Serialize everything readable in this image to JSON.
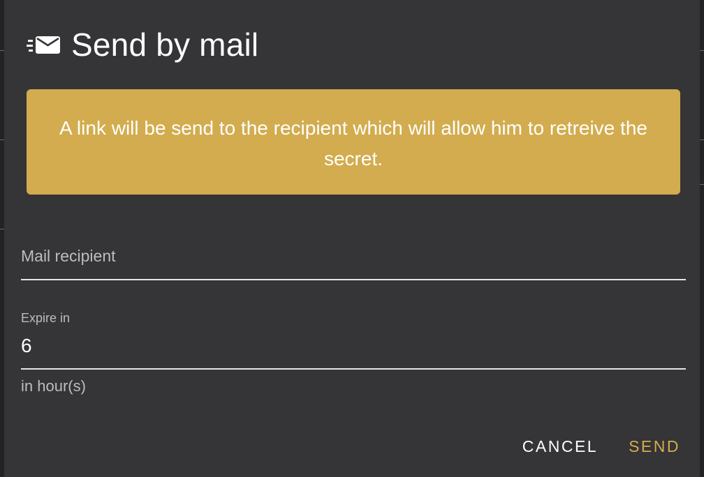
{
  "dialog": {
    "title": "Send by mail",
    "icon": "send-mail-icon"
  },
  "alert": {
    "message": "A link will be send to the recipient which will allow him to retreive the secret.",
    "color": "#d2ac4e"
  },
  "recipient_field": {
    "label": "Mail recipient",
    "value": ""
  },
  "expire_field": {
    "label": "Expire in",
    "value": "6",
    "hint": "in hour(s)"
  },
  "actions": {
    "cancel_label": "CANCEL",
    "send_label": "SEND"
  },
  "colors": {
    "accent": "#d2ac4e",
    "dialog_background": "#353436"
  }
}
